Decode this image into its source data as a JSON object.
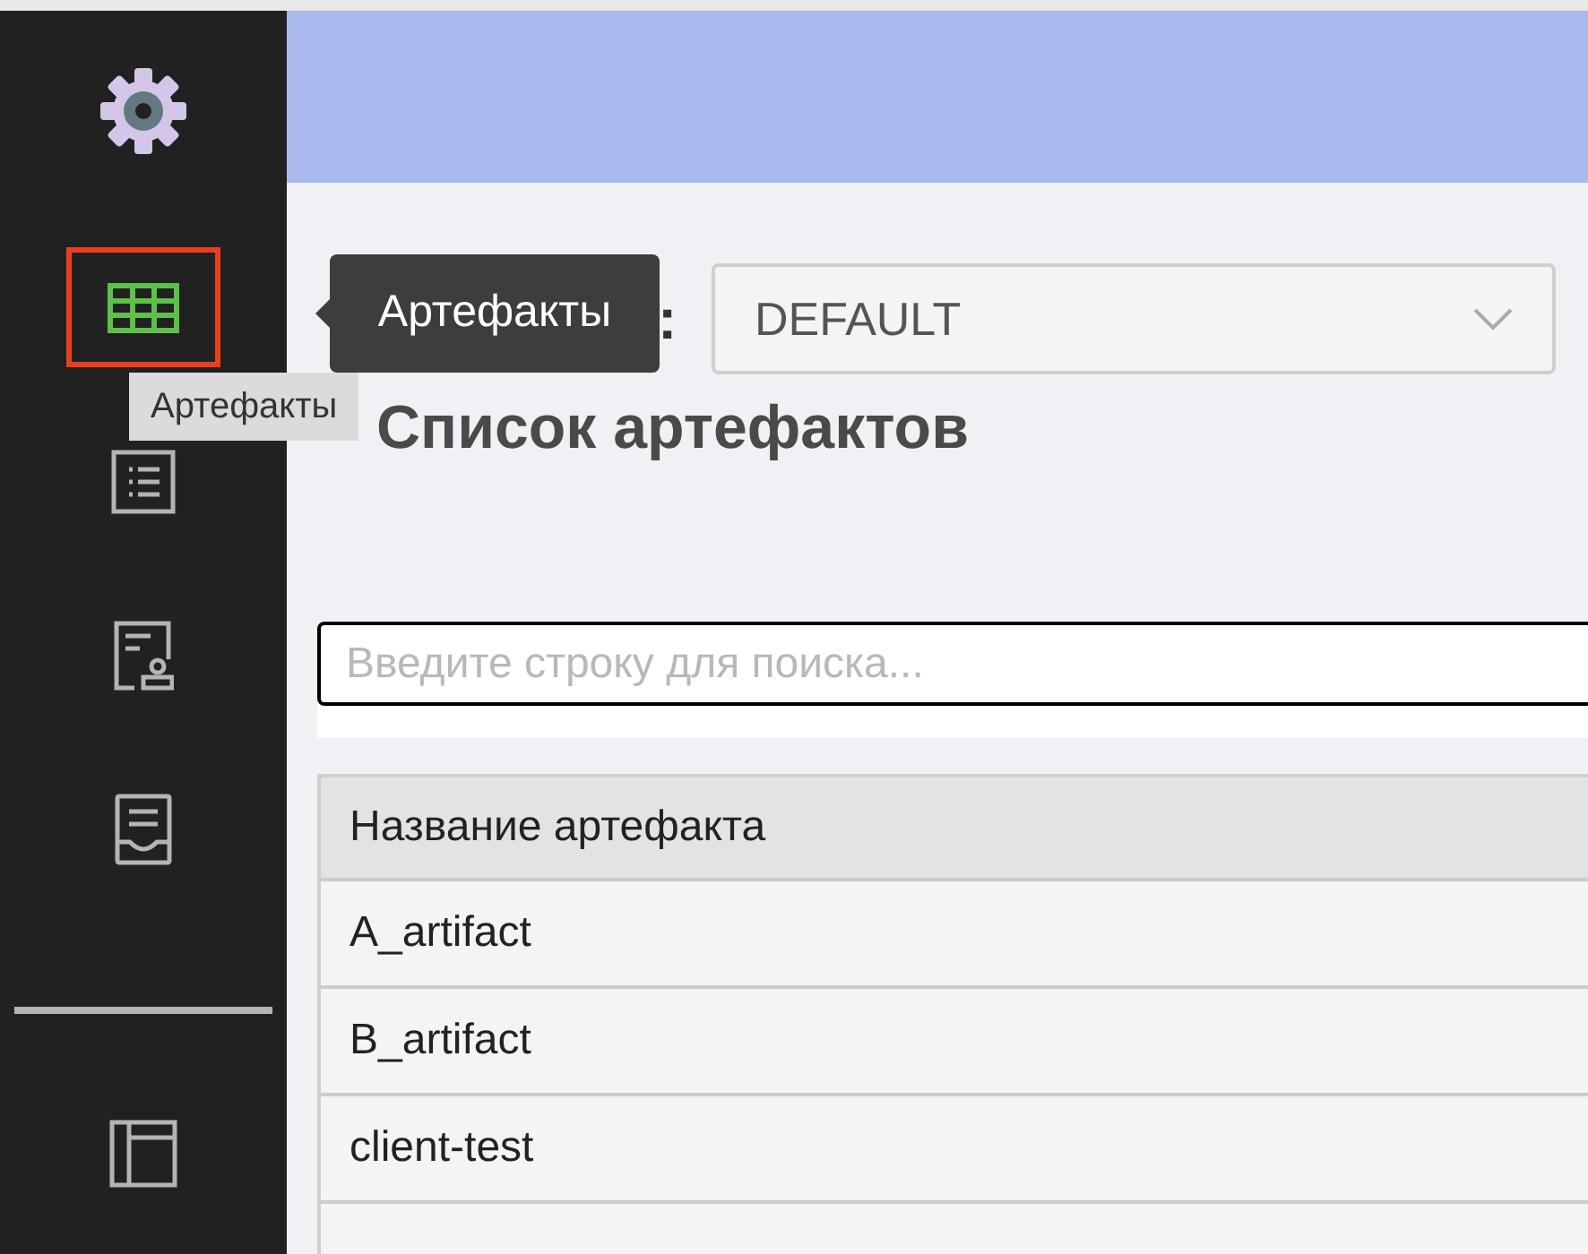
{
  "sidebar": {
    "items": [
      {
        "selected": true
      },
      {
        "selected": false
      },
      {
        "selected": false
      },
      {
        "selected": false
      }
    ],
    "bottom_items": [
      {
        "selected": false
      }
    ]
  },
  "tooltip": {
    "text": "Артефакты"
  },
  "hover_hint": {
    "text": "Артефакты"
  },
  "project": {
    "label": ":",
    "value": "DEFAULT"
  },
  "page_title": "Список артефактов",
  "search": {
    "placeholder": "Введите строку для поиска..."
  },
  "table": {
    "columns": [
      "Название артефакта"
    ],
    "rows": [
      {
        "name": "A_artifact"
      },
      {
        "name": "B_artifact"
      },
      {
        "name": "client-test"
      }
    ]
  }
}
